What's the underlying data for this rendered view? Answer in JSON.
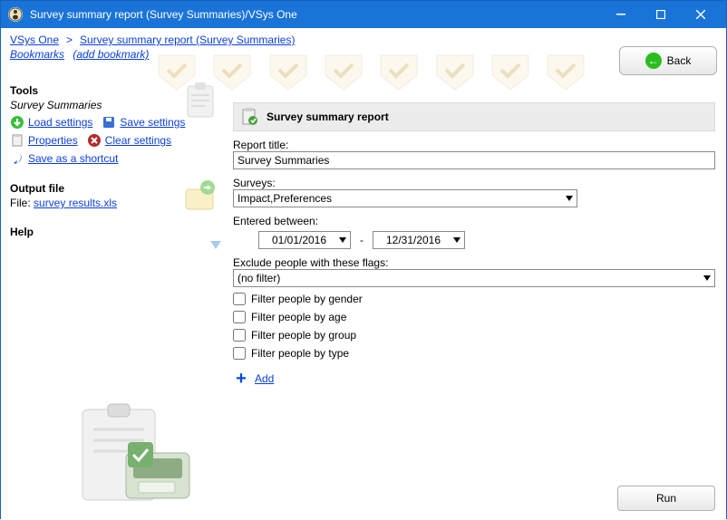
{
  "window": {
    "title": "Survey summary report (Survey Summaries)/VSys One"
  },
  "breadcrumb": {
    "root": "VSys One",
    "sep": ">",
    "current": "Survey summary report (Survey Summaries)"
  },
  "bookmarks": {
    "label": "Bookmarks",
    "add": "(add bookmark)"
  },
  "back": {
    "label": "Back"
  },
  "sidebar": {
    "tools": {
      "heading": "Tools",
      "subtitle": "Survey Summaries",
      "load": "Load settings",
      "save": "Save settings",
      "properties": "Properties",
      "clear": "Clear settings",
      "shortcut": "Save as a shortcut"
    },
    "output": {
      "heading": "Output file",
      "file_prefix": "File: ",
      "file_link": "survey results.xls"
    },
    "help": {
      "heading": "Help"
    }
  },
  "form": {
    "panel_title": "Survey summary report",
    "report_title_label": "Report title:",
    "report_title_value": "Survey Summaries",
    "surveys_label": "Surveys:",
    "surveys_value": "Impact,Preferences",
    "entered_label": "Entered between:",
    "date_from": "01/01/2016",
    "date_dash": "-",
    "date_to": "12/31/2016",
    "exclude_label": "Exclude people with these flags:",
    "exclude_value": "(no filter)",
    "filters": {
      "gender": "Filter people by gender",
      "age": "Filter people by age",
      "group": "Filter people by group",
      "type": "Filter people by type"
    },
    "add_label": "Add"
  },
  "run": {
    "label": "Run"
  }
}
